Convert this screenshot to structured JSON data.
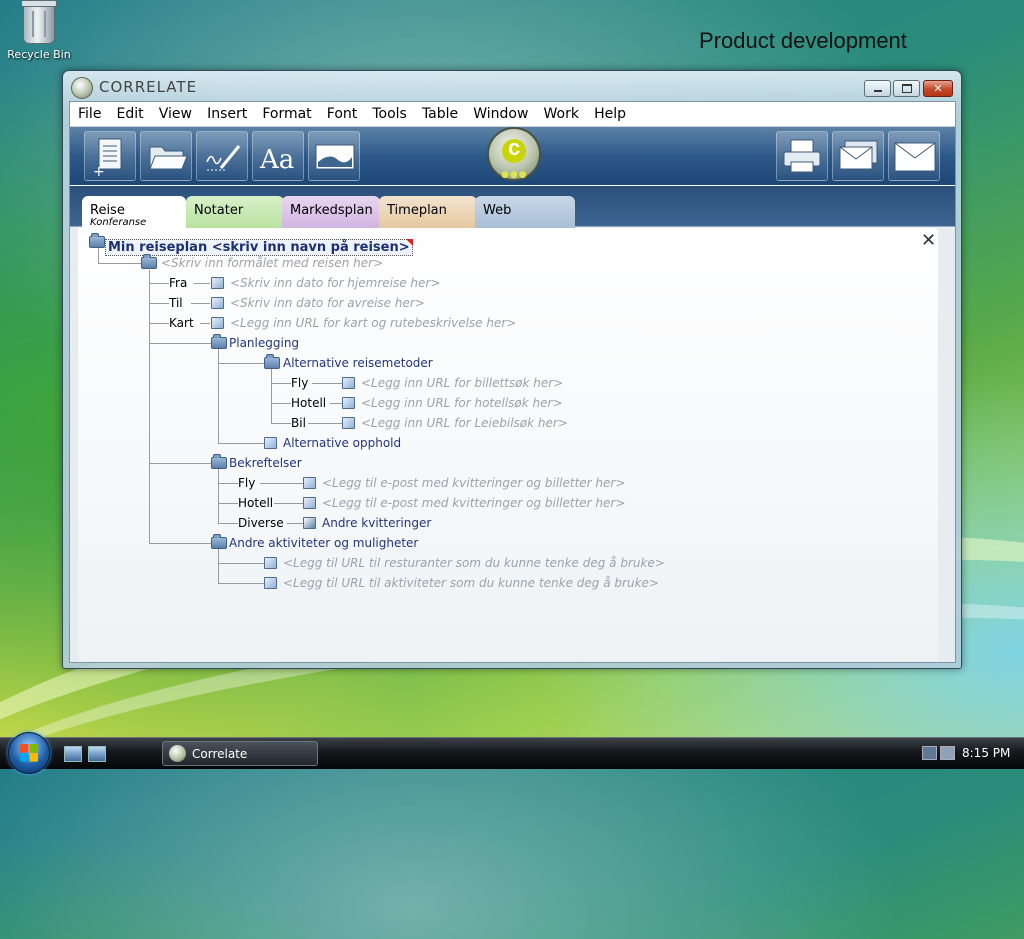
{
  "desktop": {
    "recycle_bin": "Recycle Bin",
    "caption": "Product development"
  },
  "window": {
    "title": "CORRELATE",
    "controls": {
      "minimize": "",
      "maximize": "",
      "close": "✕"
    }
  },
  "menu": [
    "File",
    "Edit",
    "View",
    "Insert",
    "Format",
    "Font",
    "Tools",
    "Table",
    "Window",
    "Work",
    "Help"
  ],
  "toolbar": {
    "icons": [
      "new-document-icon",
      "open-folder-icon",
      "pen-signature-icon",
      "font-icon",
      "image-icon",
      "printer-icon",
      "multiple-mail-icon",
      "mail-icon"
    ],
    "font_label": "Aa"
  },
  "tabs": [
    {
      "label": "Reise",
      "sub": "Konferanse",
      "color": "#ffffff"
    },
    {
      "label": "Notater",
      "color": "#c6e8b0"
    },
    {
      "label": "Markedsplan",
      "color": "#d9c2e7"
    },
    {
      "label": "Timeplan",
      "color": "#ebd4b4"
    },
    {
      "label": "Web",
      "color": "#b6c9de"
    }
  ],
  "mindmap": {
    "root": "Min reiseplan <skriv inn navn på reisen>",
    "purpose": "<Skriv inn formålet med reisen her>",
    "fra_label": "Fra",
    "fra_value": "<Skriv inn dato for hjemreise her>",
    "til_label": "Til",
    "til_value": "<Skriv inn dato for avreise her>",
    "kart_label": "Kart",
    "kart_value": "<Legg inn URL for kart og rutebeskrivelse her>",
    "planlegging": "Planlegging",
    "alt_reisemetoder": "Alternative reisemetoder",
    "fly_label": "Fly",
    "fly_value": "<Legg inn URL for billettsøk her>",
    "hotell_label": "Hotell",
    "hotell_value": "<Legg inn URL for hotellsøk her>",
    "bil_label": "Bil",
    "bil_value": "<Legg inn URL for Leiebilsøk her>",
    "alt_opphold": "Alternative opphold",
    "bekreftelser": "Bekreftelser",
    "b_fly_label": "Fly",
    "b_fly_value": "<Legg til e-post med kvitteringer og billetter her>",
    "b_hotell_label": "Hotell",
    "b_hotell_value": "<Legg til e-post med kvitteringer og billetter her>",
    "diverse_label": "Diverse",
    "andre_kvitteringer": "Andre kvitteringer",
    "andre_aktiviteter": "Andre aktiviteter og muligheter",
    "aktiv_1": "<Legg til URL til resturanter som du kunne tenke deg å bruke>",
    "aktiv_2": "<Legg til URL til aktiviteter som du kunne tenke deg å bruke>"
  },
  "taskbar": {
    "task_label": "Correlate",
    "clock": "8:15 PM"
  }
}
